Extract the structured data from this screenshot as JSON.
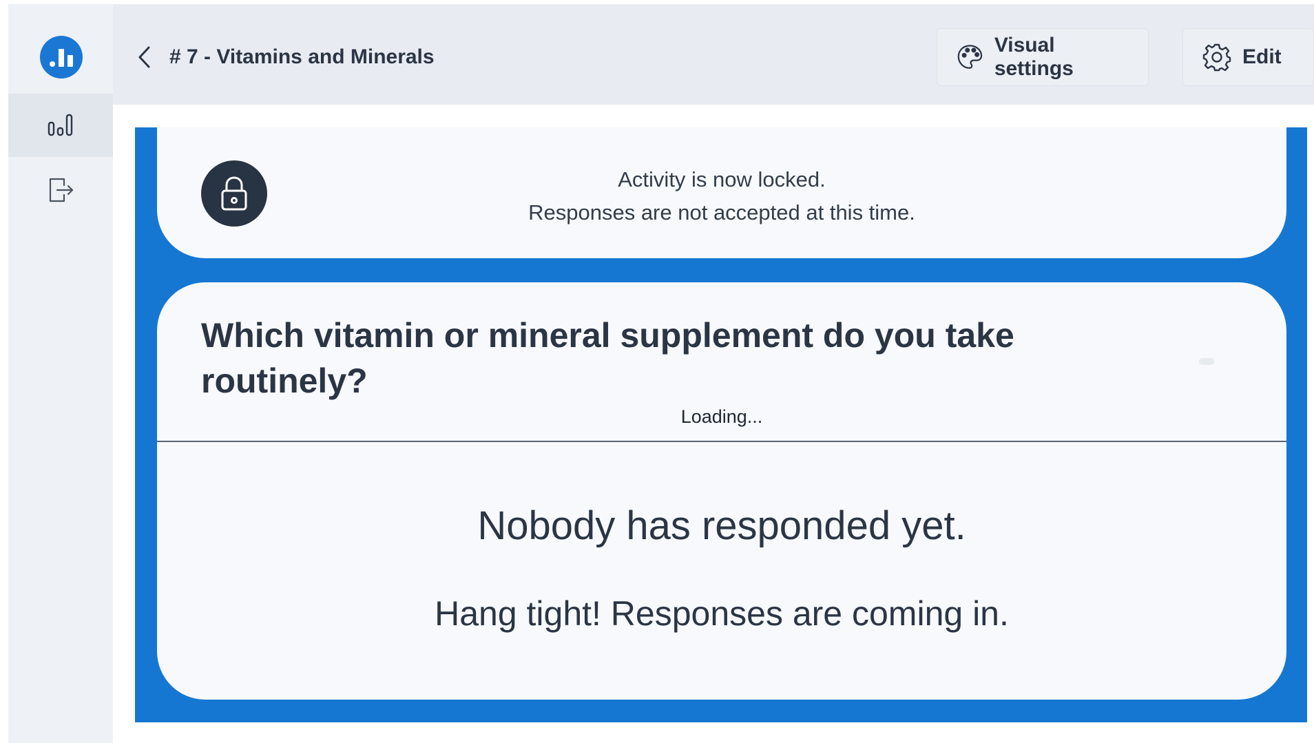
{
  "app": {
    "brand_color": "#1677d2",
    "logo_icon": "mentimeter-logo-icon"
  },
  "sidebar": {
    "items": [
      {
        "id": "results",
        "icon": "bar-chart-icon",
        "active": true
      },
      {
        "id": "exit",
        "icon": "exit-icon",
        "active": false
      }
    ]
  },
  "header": {
    "title": "# 7 - Vitamins and Minerals",
    "back_icon": "chevron-left-icon",
    "visual_settings_label": "Visual settings",
    "visual_settings_icon": "palette-icon",
    "edit_label": "Edit",
    "edit_icon": "gear-icon"
  },
  "lock_notice": {
    "icon": "lock-icon",
    "line1": "Activity is now locked.",
    "line2": "Responses are not accepted at this time."
  },
  "question": {
    "text": "Which vitamin or mineral supplement do you take routinely?",
    "loading": "Loading...",
    "empty_title": "Nobody has responded yet.",
    "empty_subtitle": "Hang tight! Responses are coming in."
  }
}
